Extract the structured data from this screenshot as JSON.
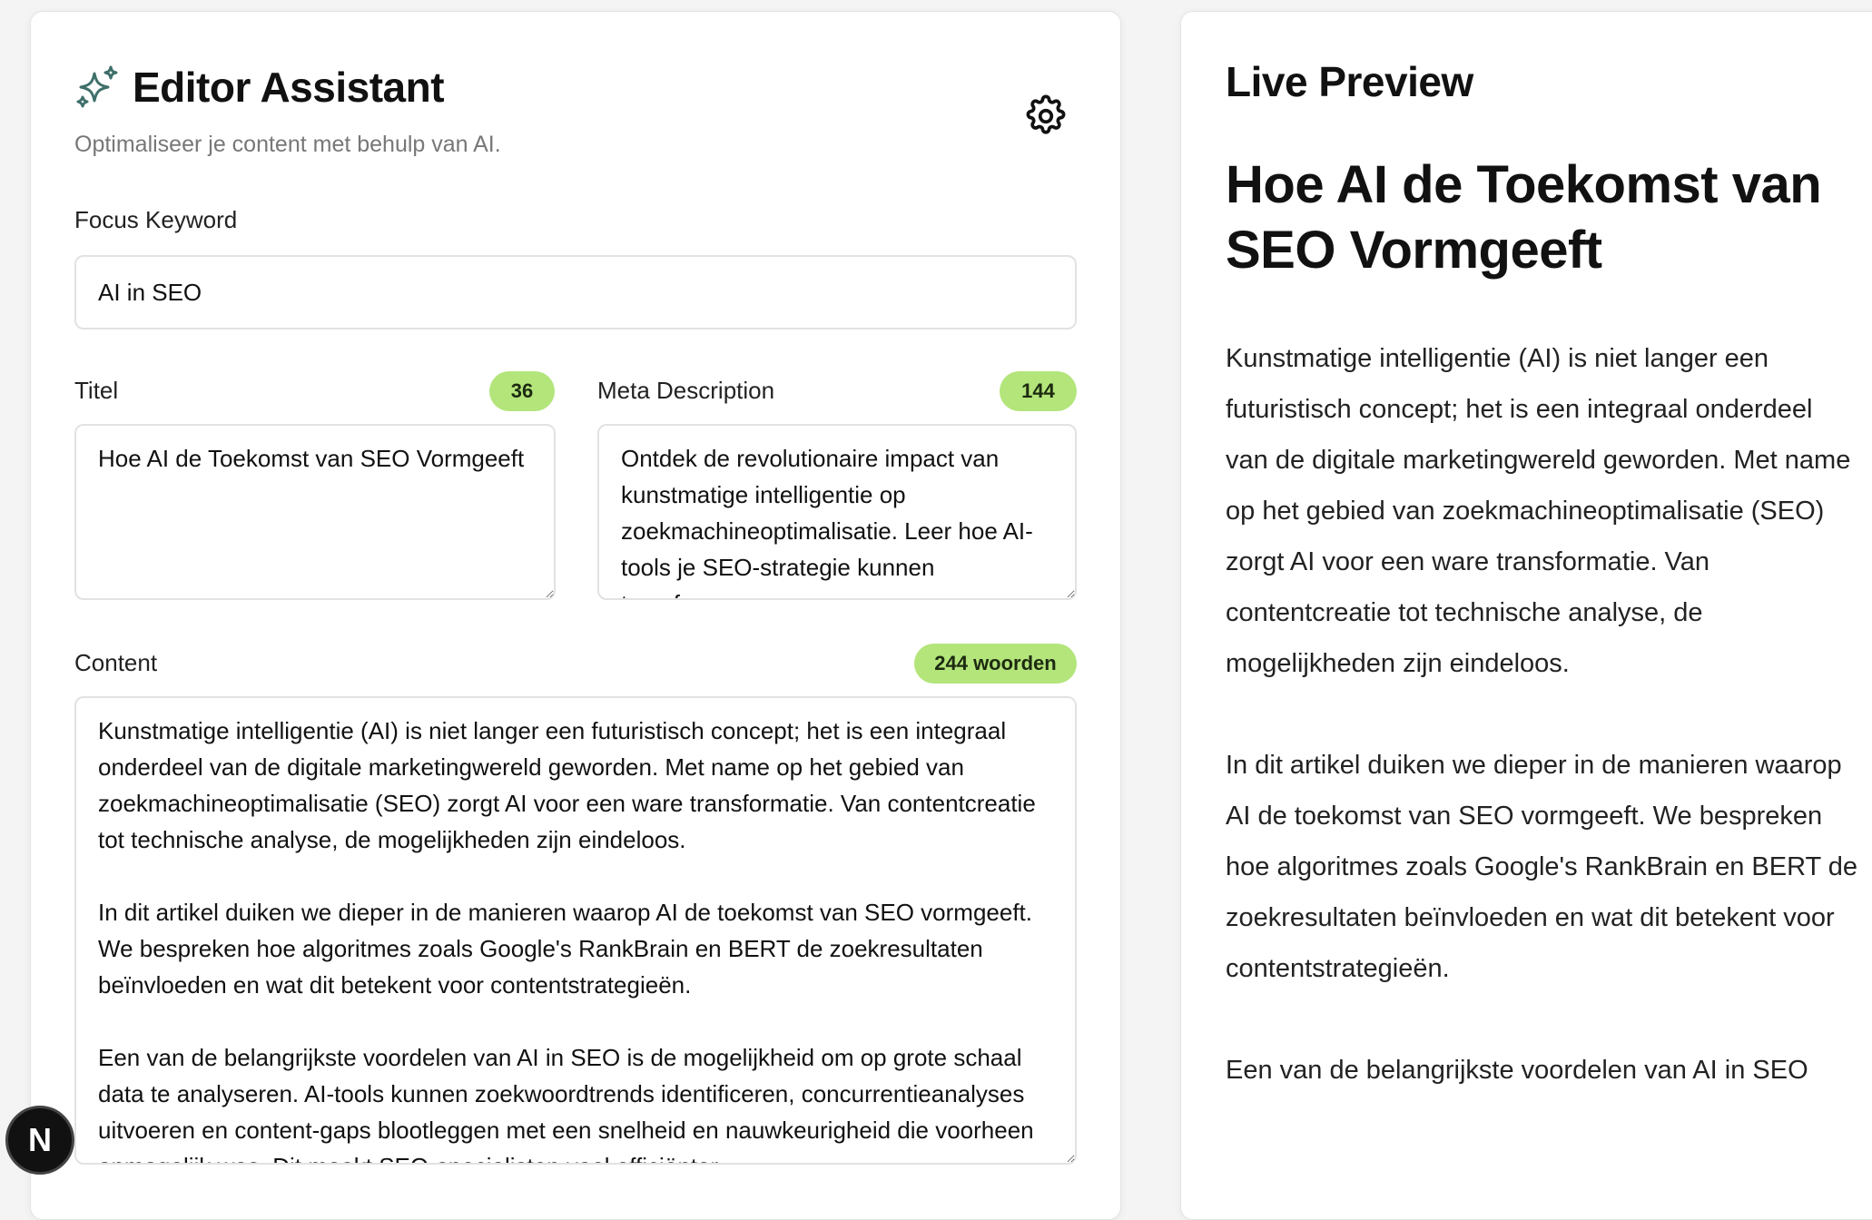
{
  "editor": {
    "title": "Editor Assistant",
    "subtitle": "Optimaliseer je content met behulp van AI.",
    "focus_keyword": {
      "label": "Focus Keyword",
      "value": "AI in SEO"
    },
    "titel": {
      "label": "Titel",
      "count": "36",
      "value": "Hoe AI de Toekomst van SEO Vormgeeft"
    },
    "meta": {
      "label": "Meta Description",
      "count": "144",
      "value": "Ontdek de revolutionaire impact van kunstmatige intelligentie op zoekmachineoptimalisatie. Leer hoe AI-tools je SEO-strategie kunnen transformeren."
    },
    "content": {
      "label": "Content",
      "count": "244 woorden",
      "value": "Kunstmatige intelligentie (AI) is niet langer een futuristisch concept; het is een integraal onderdeel van de digitale marketingwereld geworden. Met name op het gebied van zoekmachineoptimalisatie (SEO) zorgt AI voor een ware transformatie. Van contentcreatie tot technische analyse, de mogelijkheden zijn eindeloos.\n\nIn dit artikel duiken we dieper in de manieren waarop AI de toekomst van SEO vormgeeft. We bespreken hoe algoritmes zoals Google's RankBrain en BERT de zoekresultaten beïnvloeden en wat dit betekent voor contentstrategieën.\n\nEen van de belangrijkste voordelen van AI in SEO is de mogelijkheid om op grote schaal data te analyseren. AI-tools kunnen zoekwoordtrends identificeren, concurrentieanalyses uitvoeren en content-gaps blootleggen met een snelheid en nauwkeurigheid die voorheen onmogelijk was. Dit maakt SEO-specialisten veel efficiënter."
    }
  },
  "preview": {
    "heading": "Live Preview",
    "title": "Hoe AI de Toekomst van SEO Vormgeeft",
    "paragraphs": [
      "Kunstmatige intelligentie (AI) is niet langer een futuristisch concept; het is een integraal onderdeel van de digitale marketingwereld geworden. Met name op het gebied van zoekmachineoptimalisatie (SEO) zorgt AI voor een ware transformatie. Van contentcreatie tot technische analyse, de mogelijkheden zijn eindeloos.",
      "In dit artikel duiken we dieper in de manieren waarop AI de toekomst van SEO vormgeeft. We bespreken hoe algoritmes zoals Google's RankBrain en BERT de zoekresultaten beïnvloeden en wat dit betekent voor contentstrategieën.",
      "Een van de belangrijkste voordelen van AI in SEO"
    ]
  },
  "dev_badge": {
    "letter": "N"
  },
  "icons": {
    "title": "sparkles-icon",
    "settings": "gear-icon"
  },
  "colors": {
    "badge": "#b3e57b",
    "accent_icon": "#3f6f6a"
  }
}
